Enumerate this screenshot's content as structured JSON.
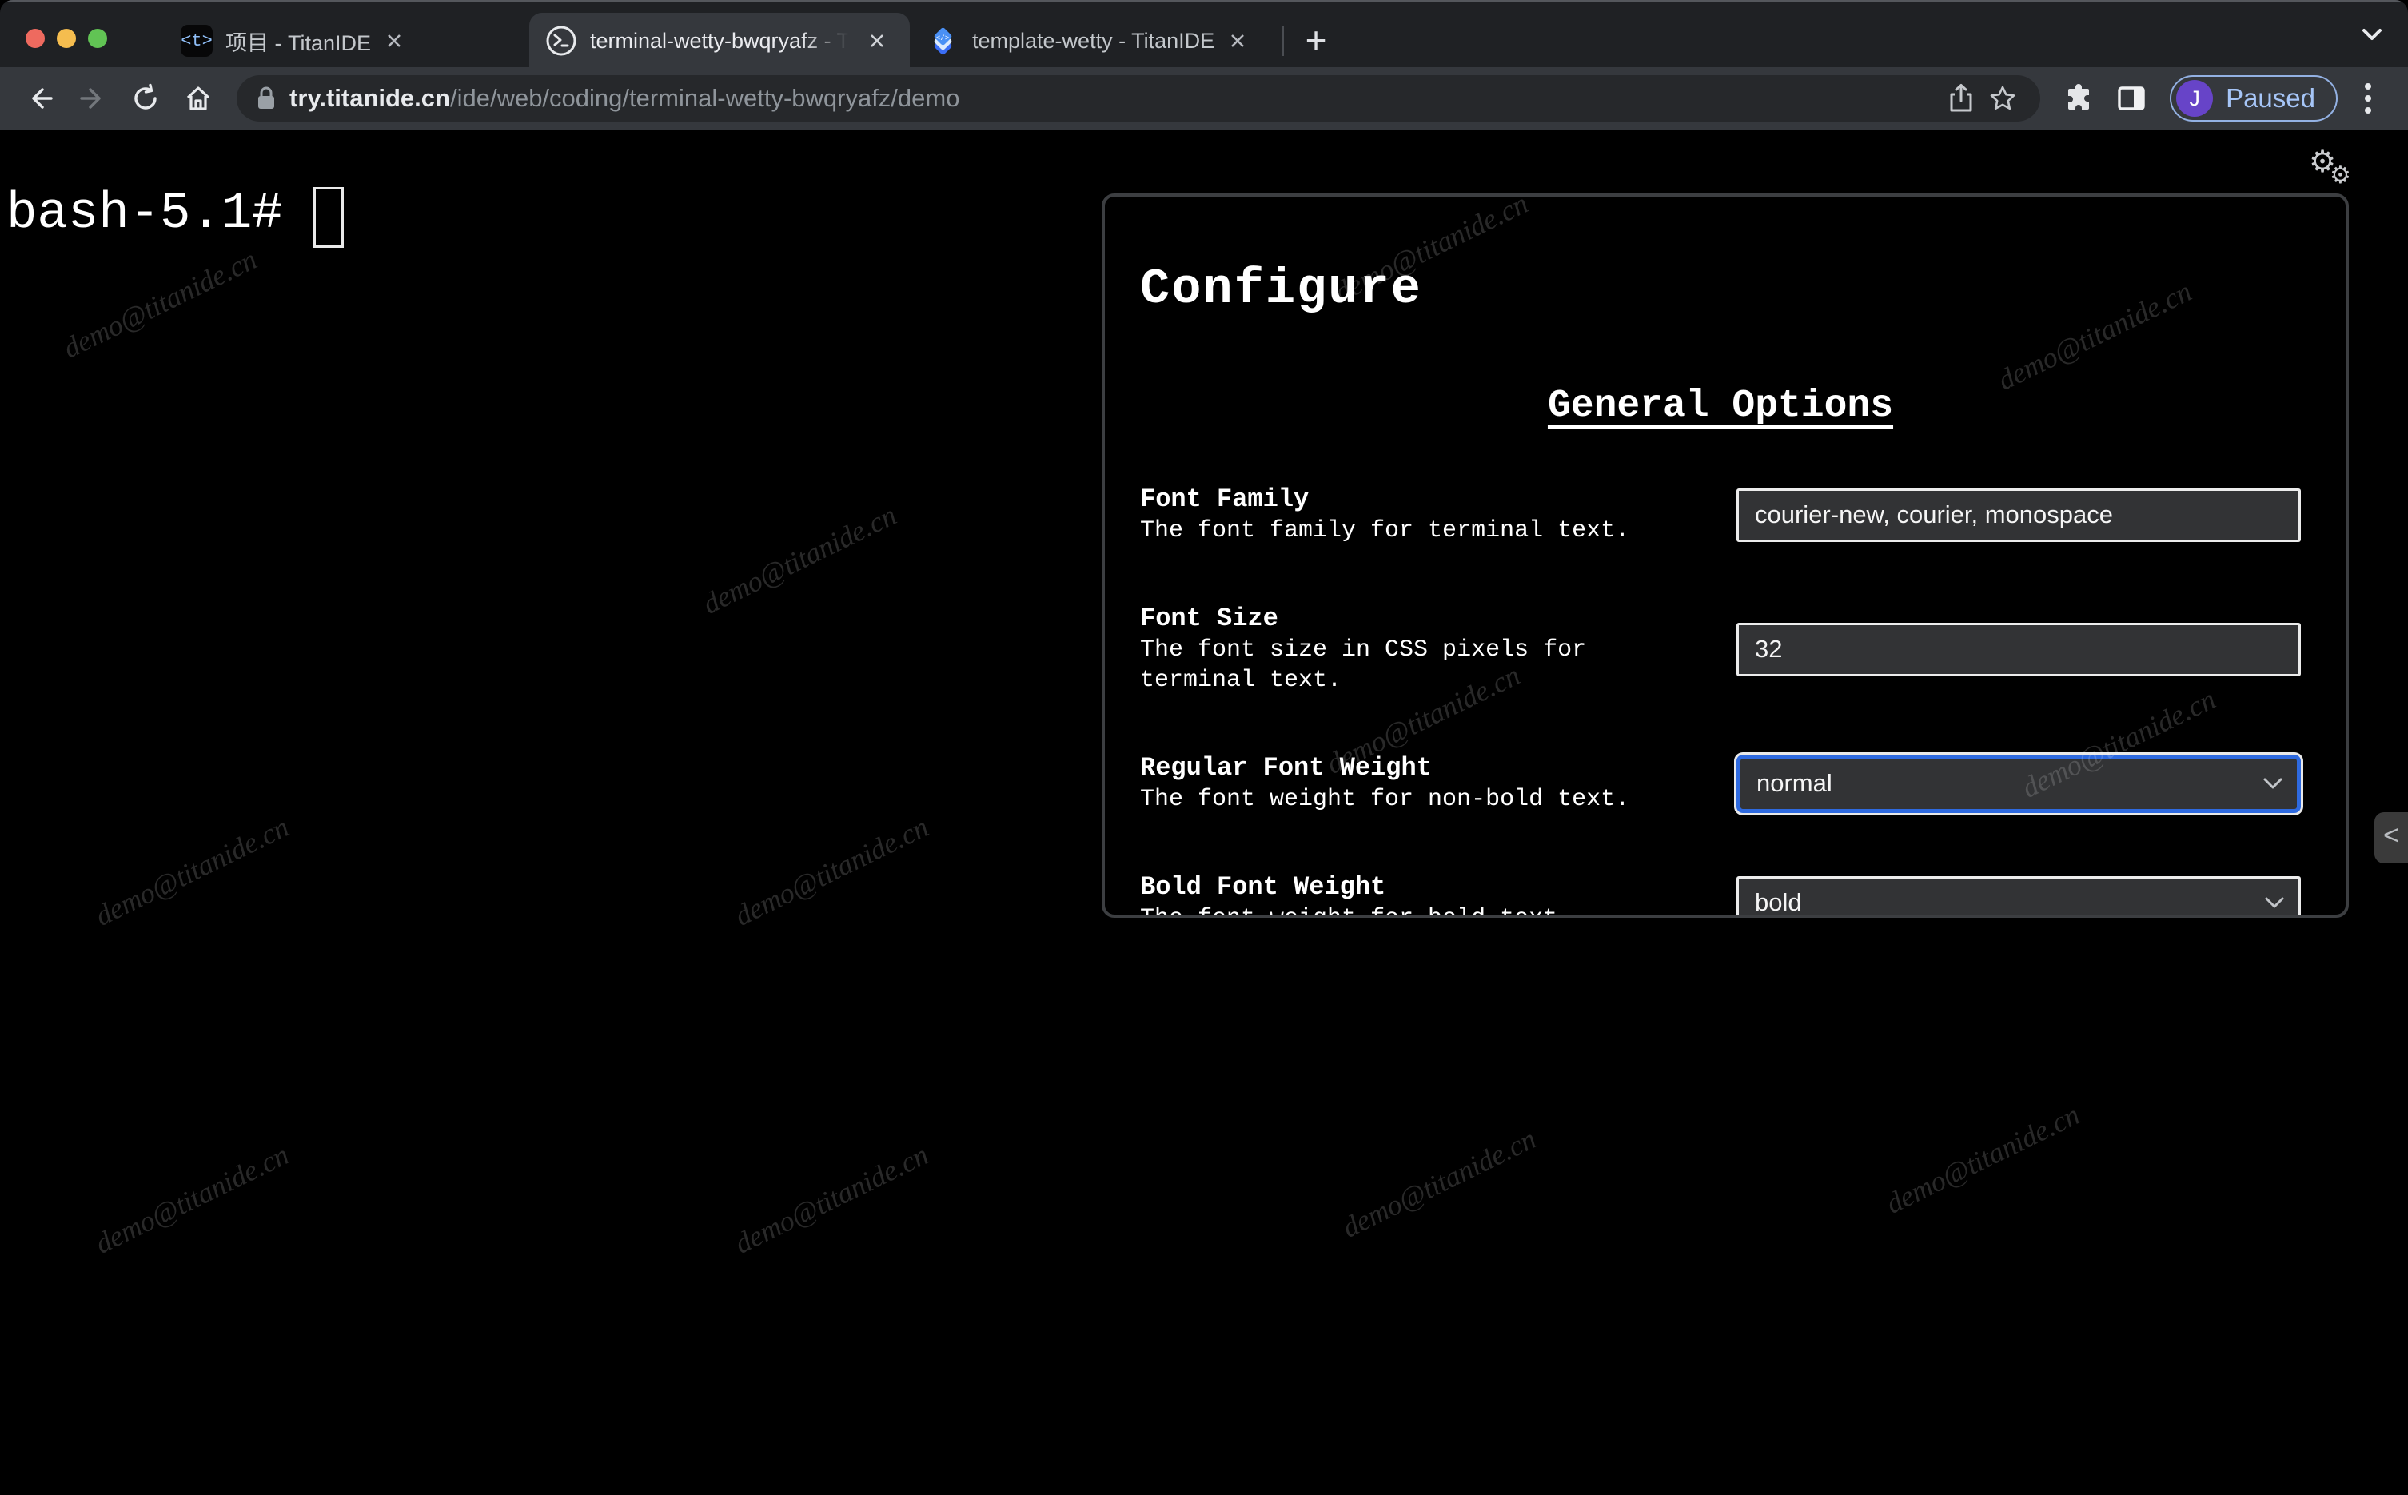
{
  "browser": {
    "tabs": [
      {
        "title": "项目 - TitanIDE",
        "favicon_text": "<t>"
      },
      {
        "title": "terminal-wetty-bwqryafz - Tita"
      },
      {
        "title": "template-wetty - TitanIDE"
      }
    ],
    "new_tab_label": "+",
    "url": {
      "domain": "try.titanide.cn",
      "path": "/ide/web/coding/terminal-wetty-bwqryafz/demo"
    },
    "profile": {
      "initial": "J",
      "status": "Paused"
    }
  },
  "terminal": {
    "prompt": "bash-5.1#"
  },
  "config_panel": {
    "title": "Configure",
    "section": "General Options",
    "rows": [
      {
        "label": "Font Family",
        "description": "The font family for terminal text.",
        "value": "courier-new, courier, monospace"
      },
      {
        "label": "Font Size",
        "description": "The font size in CSS pixels for terminal text.",
        "value": "32"
      },
      {
        "label": "Regular Font Weight",
        "description": "The font weight for non-bold text.",
        "value": "normal"
      },
      {
        "label": "Bold Font Weight",
        "description": "The font weight for bold text.",
        "value": "bold"
      }
    ]
  },
  "edge_handle_glyph": "<",
  "watermark": {
    "text": "demo@titanide.cn"
  },
  "colors": {
    "accent_blue": "#2e6ae0",
    "profile_purple": "#6744c8",
    "paused_blue": "#a6c5f7",
    "toolbar": "#35383d",
    "tabstrip": "#1f2124"
  }
}
